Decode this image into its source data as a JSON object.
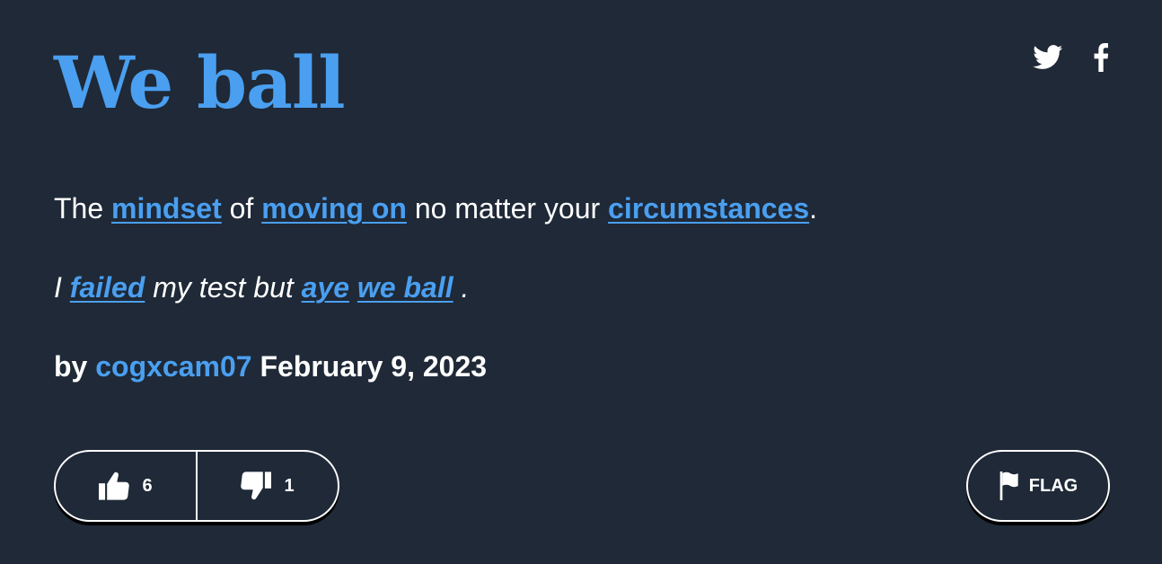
{
  "entry": {
    "word": "We ball",
    "meaning": {
      "t1": "The ",
      "link1": "mindset",
      "t2": " of ",
      "link2": "moving on",
      "t3": " no matter your ",
      "link3": "circumstances",
      "t4": "."
    },
    "example": {
      "t1": "I ",
      "link1": "failed",
      "t2": " my test but ",
      "link2": "aye",
      "t3": " ",
      "link3": "we ball",
      "t4": " ."
    },
    "contributor": {
      "by": "by ",
      "author": "cogxcam07",
      "date": " February 9, 2023"
    }
  },
  "share": {
    "twitter_icon": "twitter-icon",
    "facebook_icon": "facebook-icon"
  },
  "votes": {
    "up_count": "6",
    "down_count": "1",
    "up_icon": "thumbs-up-icon",
    "down_icon": "thumbs-down-icon"
  },
  "flag": {
    "label": "FLAG",
    "icon": "flag-icon"
  },
  "colors": {
    "background": "#1f2937",
    "accent": "#4a9ff0",
    "text": "#ffffff"
  }
}
